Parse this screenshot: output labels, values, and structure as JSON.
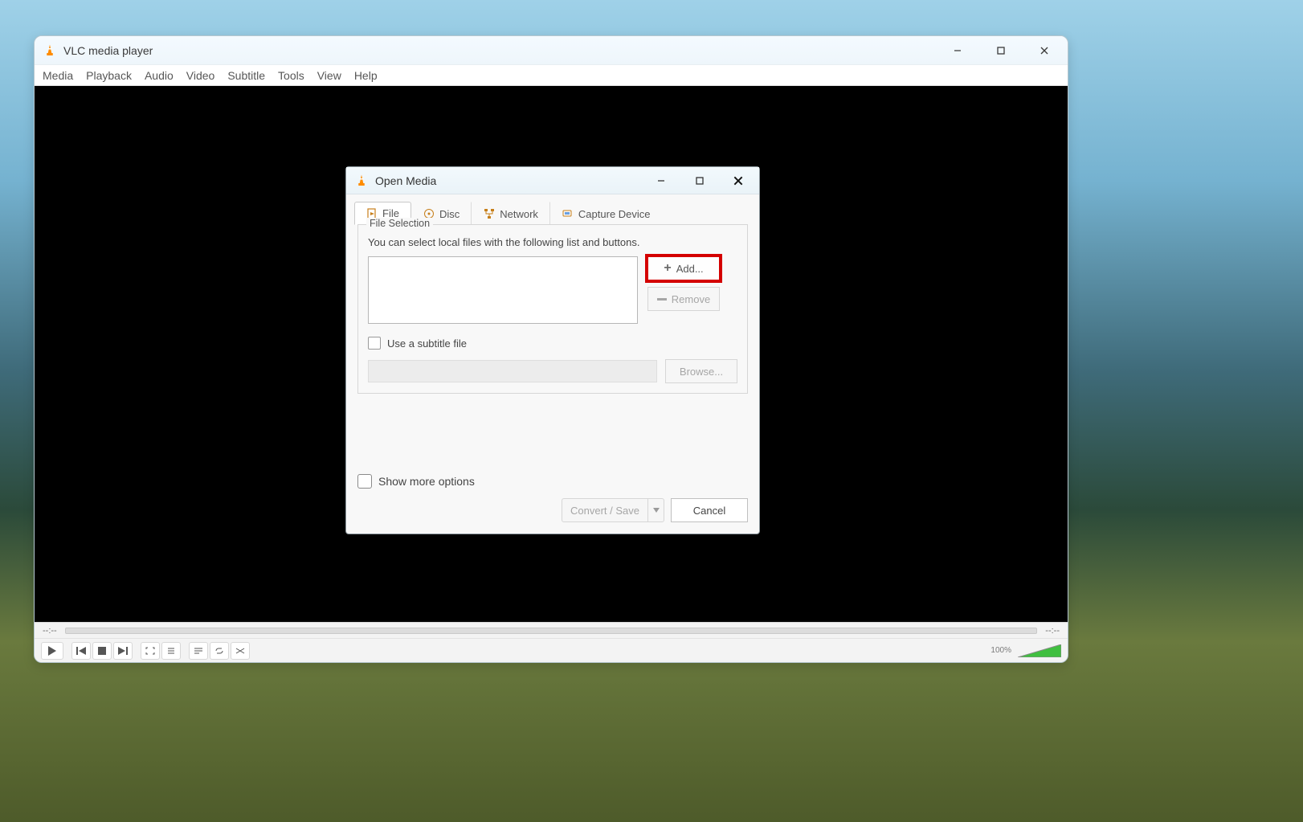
{
  "main": {
    "title": "VLC media player",
    "menu": [
      "Media",
      "Playback",
      "Audio",
      "Video",
      "Subtitle",
      "Tools",
      "View",
      "Help"
    ],
    "time_left": "--:--",
    "time_right": "--:--",
    "volume_label": "100%"
  },
  "dialog": {
    "title": "Open Media",
    "tabs": [
      {
        "label": "File",
        "active": true
      },
      {
        "label": "Disc",
        "active": false
      },
      {
        "label": "Network",
        "active": false
      },
      {
        "label": "Capture Device",
        "active": false
      }
    ],
    "file_selection": {
      "legend": "File Selection",
      "hint": "You can select local files with the following list and buttons.",
      "add_label": "Add...",
      "remove_label": "Remove"
    },
    "subtitle": {
      "checkbox_label": "Use a subtitle file",
      "browse_label": "Browse..."
    },
    "more_label": "Show more options",
    "convert_label": "Convert / Save",
    "cancel_label": "Cancel"
  },
  "icons": {
    "vlc_cone": "vlc-cone-icon"
  }
}
